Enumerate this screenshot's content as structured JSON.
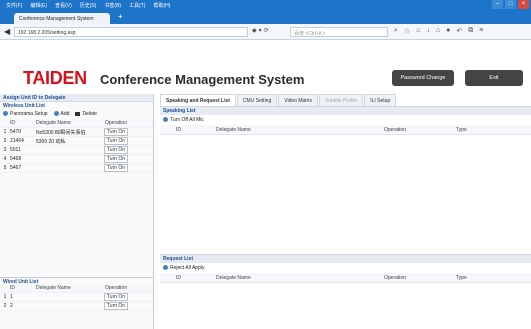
{
  "browser": {
    "menu": [
      "文件(F)",
      "编辑(E)",
      "查看(V)",
      "历史(S)",
      "书签(B)",
      "工具(T)",
      "帮助(H)"
    ],
    "tab_title": "Conference Management System",
    "url": "192.168.2.205/setting.asp",
    "search_placeholder": "百度 <Ctrl+K>"
  },
  "header": {
    "logo": "TAIDEN",
    "title": "Conference Management System",
    "password_button": "Password Change",
    "exit_button": "Exit"
  },
  "left": {
    "panel_title": "Assign Unit ID to Delegate",
    "wireless": {
      "title": "Wireless Unit List",
      "buttons": [
        "Panorama Setup",
        "Add",
        "Delete"
      ],
      "headers": [
        "ID",
        "Delegate Name",
        "Operation"
      ],
      "rows": [
        {
          "idx": "1",
          "id": "5470",
          "name": "No5300 80瞬间失事伯",
          "op": "Turn On"
        },
        {
          "idx": "2",
          "id": "21464",
          "name": "5300 20 动私",
          "op": "Turn On"
        },
        {
          "idx": "3",
          "id": "5011",
          "name": "",
          "op": "Turn On"
        },
        {
          "idx": "4",
          "id": "5468",
          "name": "",
          "op": "Turn On"
        },
        {
          "idx": "5",
          "id": "5467",
          "name": "",
          "op": "Turn On"
        }
      ]
    },
    "wired": {
      "title": "Wired Unit List",
      "headers": [
        "ID",
        "Delegate Name",
        "Operation"
      ],
      "rows": [
        {
          "idx": "1",
          "id": "1",
          "name": "",
          "op": "Turn On"
        },
        {
          "idx": "2",
          "id": "2",
          "name": "",
          "op": "Turn On"
        }
      ]
    }
  },
  "right": {
    "tabs": [
      "Speaking and Request List",
      "CMU Setting",
      "Video Matrix",
      "Subtitle Profile",
      "ILI Setup"
    ],
    "speaking": {
      "title": "Speaking List",
      "action": "Turn Off All Mic",
      "headers": [
        "ID",
        "Delegate Name",
        "Operation",
        "Type"
      ]
    },
    "request": {
      "title": "Request List",
      "action": "Reject All Apply",
      "headers": [
        "ID",
        "Delegate Name",
        "Operation",
        "Type"
      ]
    }
  }
}
